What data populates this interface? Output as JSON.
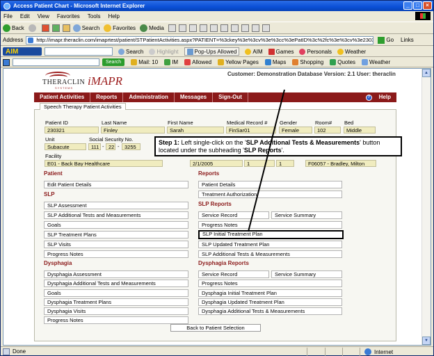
{
  "window": {
    "title": "Access Patient Chart - Microsoft Internet Explorer"
  },
  "menu": [
    "File",
    "Edit",
    "View",
    "Favorites",
    "Tools",
    "Help"
  ],
  "toolbar": {
    "back": "Back",
    "search": "Search",
    "favorites": "Favorites",
    "media": "Media"
  },
  "address": {
    "label": "Address",
    "url": "http://imapr.theraclin.com/imaprtest/patient/STPatientActivities.aspx?PATIENT=%3ckey%3e%3cv%3e%3cc%3ePatID%3c%2fc%3e%3cv%3e23032",
    "go": "Go",
    "links": "Links"
  },
  "aim": {
    "logo": "AIM",
    "search": "Search",
    "highlight": "Highlight",
    "popups": "Pop-Ups Allowed",
    "aim": "AIM",
    "games": "Games",
    "personals": "Personals",
    "weather": "Weather"
  },
  "searchbar": {
    "search": "Search",
    "mail": "Mail: 10",
    "im": "IM",
    "allowed": "Allowed",
    "yellowpages": "Yellow Pages",
    "maps": "Maps",
    "shopping": "Shopping",
    "quotes": "Quotes",
    "weather": "Weather"
  },
  "app": {
    "logo_theraclin": "THERACLIN",
    "logo_systems": "SYSTEMS",
    "logo_imapr": "iMAPR",
    "customer_info": "Customer: Demonstration Database Version: 2.1 User: theraclin",
    "nav": [
      "Patient Activities",
      "Reports",
      "Administration",
      "Messages",
      "Sign-Out"
    ],
    "help": "Help",
    "tab": "Speech Therapy Patient Activities"
  },
  "patient": {
    "labels": {
      "patient_id": "Patient ID",
      "last_name": "Last Name",
      "first_name": "First Name",
      "medical_record": "Medical Record #",
      "gender": "Gender",
      "room": "Room#",
      "bed": "Bed",
      "unit": "Unit",
      "ssn": "Social Security No.",
      "facility": "Facility"
    },
    "patient_id": "230321",
    "last_name": "Finley",
    "first_name": "Sarah",
    "medical_record": "FinSar01",
    "gender": "Female",
    "room": "102",
    "bed": "Middle",
    "unit": "Subacute",
    "ssn1": "111",
    "ssn2": "22",
    "ssn3": "3255",
    "facility": "E01 - Back Bay Healthcare",
    "date": "2/1/2005",
    "num1": "1",
    "num2": "1",
    "physician": "F06057 - Bradley, Milton"
  },
  "sections": {
    "patient": "Patient",
    "slp": "SLP",
    "dysphagia": "Dysphagia",
    "reports": "Reports",
    "slp_reports": "SLP Reports",
    "dysphagia_reports": "Dysphagia Reports"
  },
  "left_buttons": {
    "edit_patient": "Edit Patient Details",
    "slp_assessment": "SLP Assessment",
    "slp_additional": "SLP Additional Tests and Measurements",
    "goals": "Goals",
    "slp_treatment_plans": "SLP Treatment Plans",
    "slp_visits": "SLP Visits",
    "progress_notes": "Progress Notes",
    "dys_assessment": "Dysphagia Assessment",
    "dys_additional": "Dysphagia Additional Tests and Measurements",
    "dys_goals": "Goals",
    "dys_treatment_plans": "Dysphagia Treatment Plans",
    "dys_visits": "Dysphagia Visits",
    "dys_progress_notes": "Progress Notes"
  },
  "right_buttons": {
    "patient_details": "Patient Details",
    "treatment_auth": "Treatment Authorization",
    "service_record": "Service Record",
    "service_summary": "Service Summary",
    "progress_notes": "Progress Notes",
    "slp_initial": "SLP Initial Treatment Plan",
    "slp_updated": "SLP Updated Treatment Plan",
    "slp_additional": "SLP Additional Tests & Measurements",
    "dys_service_record": "Service Record",
    "dys_service_summary": "Service Summary",
    "dys_progress_notes": "Progress Notes",
    "dys_initial": "Dysphagia Initial Treatment Plan",
    "dys_updated": "Dysphagia Updated Treatment Plan",
    "dys_additional": "Dysphagia Additional Tests & Measurements"
  },
  "back_button": "Back to Patient Selection",
  "callout": {
    "step": "Step 1:",
    "text1": " Left single-click on the '",
    "bold1": "SLP Additional Tests & Measurements",
    "text2": "' button located under the subheading '",
    "bold2": "SLP Reports",
    "text3": "'."
  },
  "status": {
    "text": "Done",
    "zone": "Internet"
  }
}
